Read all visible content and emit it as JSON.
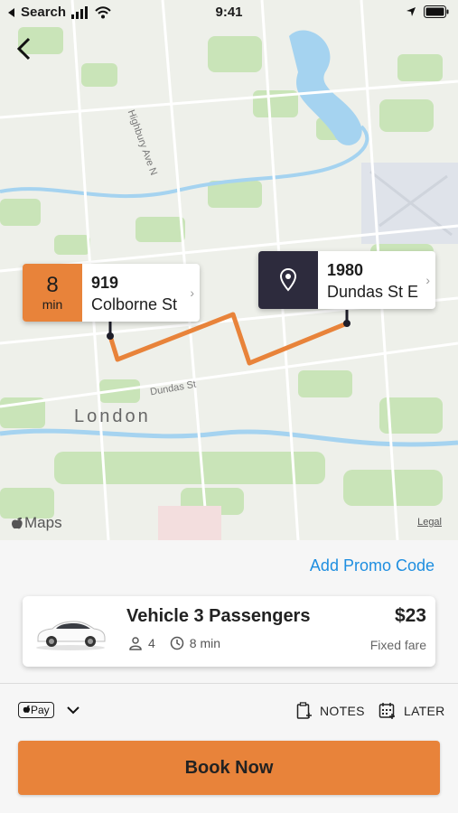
{
  "status_bar": {
    "back_app": "Search",
    "time": "9:41"
  },
  "map": {
    "street_highbury": "Highbury Ave N",
    "street_dundas": "Dundas St",
    "city": "London",
    "maps_logo": "Maps",
    "legal": "Legal",
    "origin": {
      "eta_value": "8",
      "eta_unit": "min",
      "number": "919",
      "street": "Colborne St"
    },
    "destination": {
      "icon": "location-pin-icon",
      "number": "1980",
      "street": "Dundas St E"
    },
    "colors": {
      "route": "#e8833a",
      "origin_badge": "#e8833a",
      "destination_badge": "#2d2b3d",
      "water": "#a5d3f0",
      "park": "#c9e4b8"
    }
  },
  "sheet": {
    "promo_label": "Add Promo Code",
    "vehicle": {
      "name": "Vehicle 3 Passengers",
      "passengers": "4",
      "duration": "8 min",
      "price": "$23",
      "fare_type": "Fixed fare"
    },
    "payment": {
      "method": "Pay"
    },
    "actions": {
      "notes": "NOTES",
      "later": "LATER"
    },
    "book_label": "Book Now"
  }
}
